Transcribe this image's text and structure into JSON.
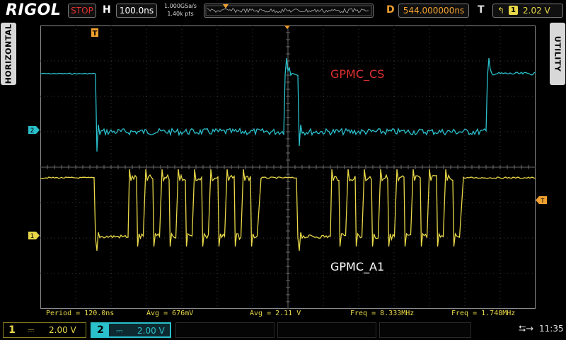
{
  "brand": "RIGOL",
  "run_status": "STOP",
  "horizontal": {
    "label": "H",
    "timebase": "100.0ns",
    "sample_rate": "1.000GSa/s",
    "memory_depth": "1.40k pts"
  },
  "delay": {
    "label": "D",
    "value": "544.000000ns"
  },
  "trigger": {
    "label": "T",
    "edge_icon": "rising-edge-icon",
    "source": "1",
    "level": "2.02 V"
  },
  "side_tabs": {
    "left": "HORIZONTAL",
    "right": "UTILITY"
  },
  "waveform_labels": {
    "cs": "GPMC_CS",
    "a1": "GPMC_A1"
  },
  "channel_markers": {
    "ch1": "1",
    "ch2": "2",
    "trigger_level": "T",
    "trigger_pos": "T"
  },
  "colors": {
    "ch1": "#e8d848",
    "ch2": "#2ac0cc",
    "grid": "#3a3a3a",
    "run_status": "#e03030",
    "delay": "#f0a030",
    "cs_label": "#e03030"
  },
  "measurements": [
    "Period = 120.0ns",
    "Avg = 676mV",
    "Avg = 2.11 V",
    "Freq = 8.333MHz",
    "Freq = 1.748MHz"
  ],
  "channels": [
    {
      "number": "1",
      "coupling": "⎓",
      "scale": "2.00 V"
    },
    {
      "number": "2",
      "coupling": "⎓",
      "scale": "2.00 V"
    }
  ],
  "status": {
    "usb_icon": "usb-icon",
    "time": "11:35"
  }
}
